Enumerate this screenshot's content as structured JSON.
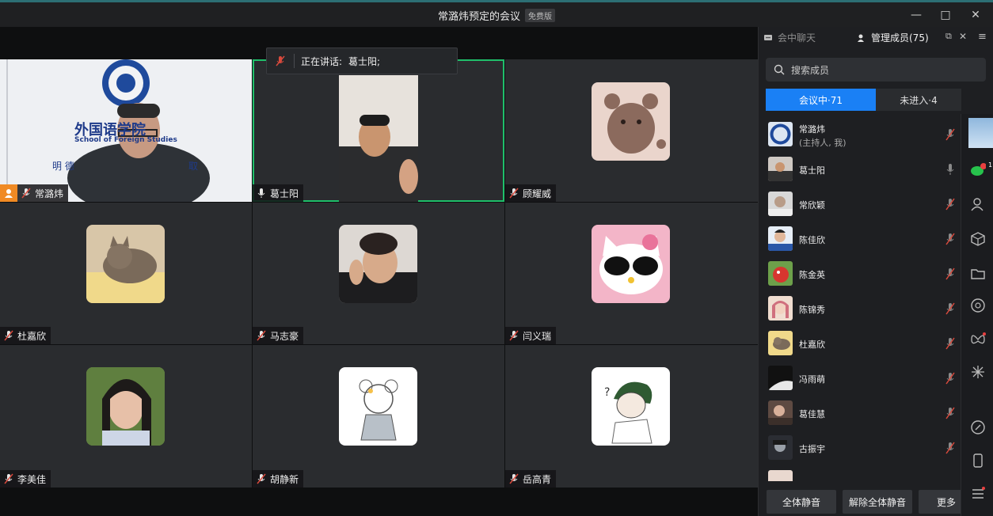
{
  "window": {
    "title": "常潞炜预定的会议",
    "badge": "免费版",
    "minimize": "—",
    "maximize": "□",
    "close": "✕"
  },
  "speaking": {
    "label": "正在讲话:",
    "name": "葛士阳;"
  },
  "tiles": [
    {
      "name": "常潞炜",
      "muted": true,
      "host": true,
      "content": "外国语学院",
      "content_sub": "School of Foreign Studies",
      "content_motto_left": "明  德",
      "content_motto_right": "取"
    },
    {
      "name": "葛士阳",
      "muted": false,
      "active": true
    },
    {
      "name": "顾耀威",
      "muted": true
    },
    {
      "name": "杜嘉欣",
      "muted": true
    },
    {
      "name": "马志豪",
      "muted": true
    },
    {
      "name": "闫义瑞",
      "muted": true
    },
    {
      "name": "李美佳",
      "muted": true
    },
    {
      "name": "胡静新",
      "muted": true
    },
    {
      "name": "岳高青",
      "muted": true
    }
  ],
  "panel": {
    "chat_tab": "会中聊天",
    "members_tab": "管理成员(75)",
    "search_placeholder": "搜索成员",
    "in_meeting": "会议中·71",
    "not_joined": "未进入·4",
    "members": [
      {
        "name": "常潞炜",
        "sub": "(主持人, 我)",
        "muted": true
      },
      {
        "name": "葛士阳",
        "muted": false
      },
      {
        "name": "常欣颖",
        "muted": true
      },
      {
        "name": "陈佳欣",
        "muted": true
      },
      {
        "name": "陈金英",
        "muted": true
      },
      {
        "name": "陈锦秀",
        "muted": true
      },
      {
        "name": "杜嘉欣",
        "muted": true
      },
      {
        "name": "冯雨萌",
        "muted": true
      },
      {
        "name": "葛佳慧",
        "muted": true
      },
      {
        "name": "古振宇",
        "muted": true
      }
    ],
    "mute_all": "全体静音",
    "unmute_all": "解除全体静音",
    "more": "更多",
    "chat_badge": "1"
  },
  "colors": {
    "accent": "#1a80f5",
    "active_border": "#1fbf6a",
    "muted_icon": "#d94a3d"
  }
}
